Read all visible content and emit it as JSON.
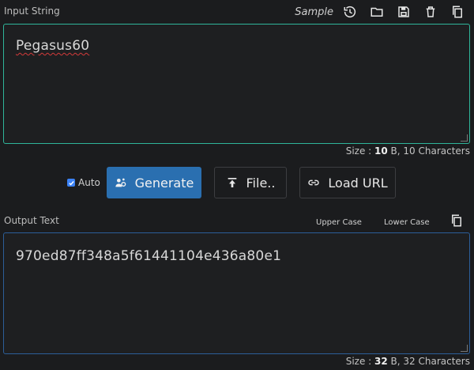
{
  "input": {
    "label": "Input String",
    "sample_label": "Sample",
    "value": "Pegasus60",
    "size_prefix": "Size : ",
    "size_bytes": "10",
    "size_suffix": " B, 10 Characters"
  },
  "toolbar_icons": [
    "history-icon",
    "folder-icon",
    "save-icon",
    "trash-icon",
    "copy-icon"
  ],
  "controls": {
    "auto_label": "Auto",
    "auto_checked": true,
    "generate_label": "Generate",
    "file_label": "File..",
    "load_url_label": "Load URL"
  },
  "output": {
    "label": "Output Text",
    "upper_case_label": "Upper Case",
    "lower_case_label": "Lower Case",
    "value": "970ed87ff348a5f61441104e436a80e1",
    "size_prefix": "Size : ",
    "size_bytes": "32",
    "size_suffix": " B, 32 Characters"
  },
  "colors": {
    "background": "#1b1c1e",
    "input_border": "#2fb59a",
    "output_border": "#2c5e99",
    "primary_button": "#2a6fb0"
  }
}
